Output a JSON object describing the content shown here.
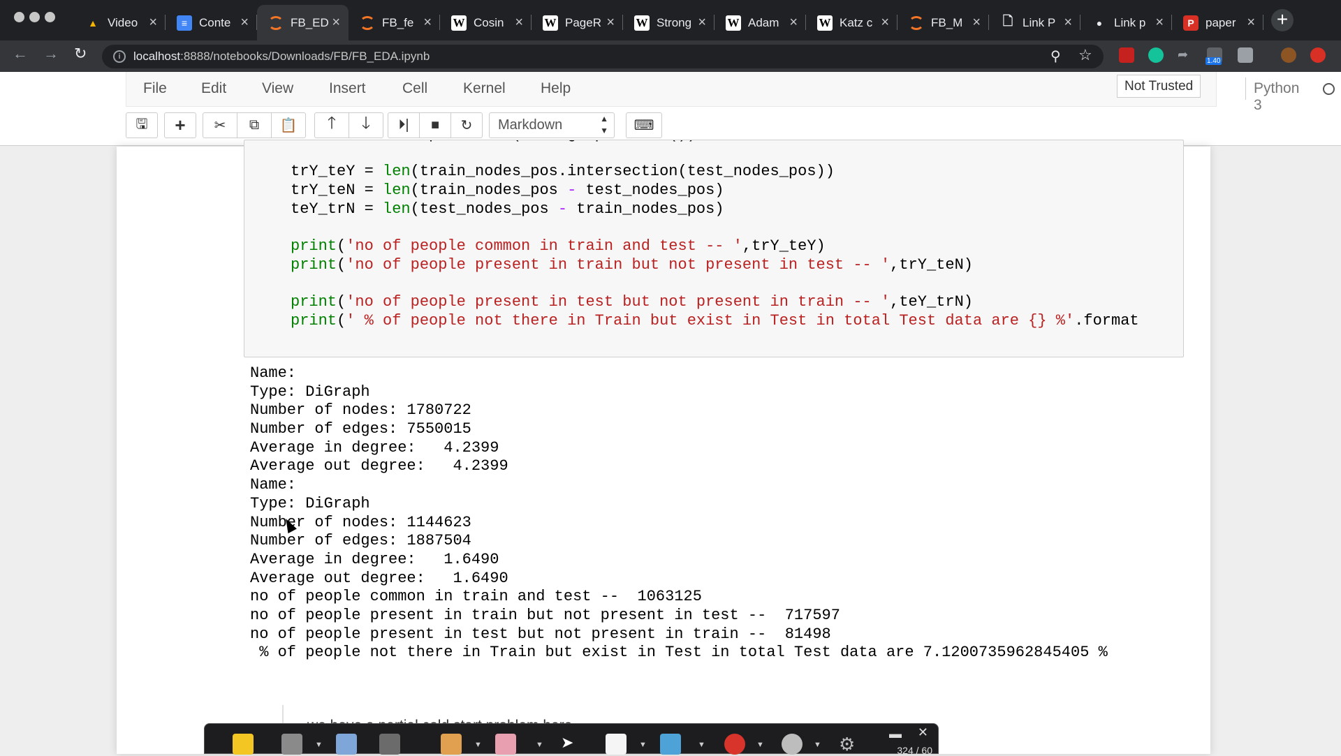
{
  "browser": {
    "tabs": [
      {
        "label": "Video",
        "icon": "google-drive-icon",
        "favclass": "drive",
        "glyph": "▲"
      },
      {
        "label": "Conte",
        "icon": "google-docs-icon",
        "favclass": "docs",
        "glyph": "≡"
      },
      {
        "label": "FB_ED",
        "icon": "jupyter-icon",
        "favclass": "jup",
        "glyph": "",
        "active": true
      },
      {
        "label": "FB_fe",
        "icon": "jupyter-icon",
        "favclass": "jup",
        "glyph": ""
      },
      {
        "label": "Cosin",
        "icon": "wikipedia-icon",
        "favclass": "wiki",
        "glyph": "W"
      },
      {
        "label": "PageR",
        "icon": "wikipedia-icon",
        "favclass": "wiki",
        "glyph": "W"
      },
      {
        "label": "Strong",
        "icon": "wikipedia-icon",
        "favclass": "wiki",
        "glyph": "W"
      },
      {
        "label": "Adam",
        "icon": "wikipedia-icon",
        "favclass": "wiki",
        "glyph": "W"
      },
      {
        "label": "Katz c",
        "icon": "wikipedia-icon",
        "favclass": "wiki",
        "glyph": "W"
      },
      {
        "label": "FB_M",
        "icon": "jupyter-icon",
        "favclass": "jup",
        "glyph": ""
      },
      {
        "label": "Link P",
        "icon": "document-icon",
        "favclass": "doc",
        "glyph": "🗋"
      },
      {
        "label": "Link p",
        "icon": "github-icon",
        "favclass": "gh",
        "glyph": "●"
      },
      {
        "label": "paper",
        "icon": "pdf-icon",
        "favclass": "pdf",
        "glyph": "P"
      }
    ],
    "url_host": "localhost",
    "url_path": ":8888/notebooks/Downloads/FB/FB_EDA.ipynb",
    "extension_badge": "1.40"
  },
  "jupyter": {
    "menu": [
      "File",
      "Edit",
      "View",
      "Insert",
      "Cell",
      "Kernel",
      "Help"
    ],
    "trusted_label": "Not Trusted",
    "kernel_name": "Python 3",
    "cell_type": "Markdown"
  },
  "code_cell": {
    "lines": [
      [
        {
          "t": "    test_nodes_pos = set(test_graph.nodes())",
          "c": ""
        }
      ],
      [],
      [
        {
          "t": "trY_teY = ",
          "c": ""
        },
        {
          "t": "len",
          "c": "kw"
        },
        {
          "t": "(train_nodes_pos.intersection(test_nodes_pos))",
          "c": ""
        }
      ],
      [
        {
          "t": "trY_teN = ",
          "c": ""
        },
        {
          "t": "len",
          "c": "kw"
        },
        {
          "t": "(train_nodes_pos ",
          "c": ""
        },
        {
          "t": "-",
          "c": "op"
        },
        {
          "t": " test_nodes_pos)",
          "c": ""
        }
      ],
      [
        {
          "t": "teY_trN = ",
          "c": ""
        },
        {
          "t": "len",
          "c": "kw"
        },
        {
          "t": "(test_nodes_pos ",
          "c": ""
        },
        {
          "t": "-",
          "c": "op"
        },
        {
          "t": " train_nodes_pos)",
          "c": ""
        }
      ],
      [],
      [
        {
          "t": "print",
          "c": "kw"
        },
        {
          "t": "(",
          "c": ""
        },
        {
          "t": "'no of people common in train and test -- '",
          "c": "str"
        },
        {
          "t": ",trY_teY)",
          "c": ""
        }
      ],
      [
        {
          "t": "print",
          "c": "kw"
        },
        {
          "t": "(",
          "c": ""
        },
        {
          "t": "'no of people present in train but not present in test -- '",
          "c": "str"
        },
        {
          "t": ",trY_teN)",
          "c": ""
        }
      ],
      [],
      [
        {
          "t": "print",
          "c": "kw"
        },
        {
          "t": "(",
          "c": ""
        },
        {
          "t": "'no of people present in test but not present in train -- '",
          "c": "str"
        },
        {
          "t": ",teY_trN)",
          "c": ""
        }
      ],
      [
        {
          "t": "print",
          "c": "kw"
        },
        {
          "t": "(",
          "c": ""
        },
        {
          "t": "' % of people not there in Train but exist in Test in total Test data are {} %'",
          "c": "str"
        },
        {
          "t": ".format",
          "c": ""
        }
      ]
    ]
  },
  "output": [
    "Name: ",
    "Type: DiGraph",
    "Number of nodes: 1780722",
    "Number of edges: 7550015",
    "Average in degree:   4.2399",
    "Average out degree:   4.2399",
    "Name: ",
    "Type: DiGraph",
    "Number of nodes: 1144623",
    "Number of edges: 1887504",
    "Average in degree:   1.6490",
    "Average out degree:   1.6490",
    "no of people common in train and test --  1063125",
    "no of people present in train but not present in test --  717597",
    "no of people present in test but not present in train --  81498",
    " % of people not there in Train but exist in Test in total Test data are 7.1200735962845405 %"
  ],
  "markdown_cell": {
    "text": "we have a partial cold start problem here"
  },
  "recorder": {
    "counter": "324 / 60"
  }
}
